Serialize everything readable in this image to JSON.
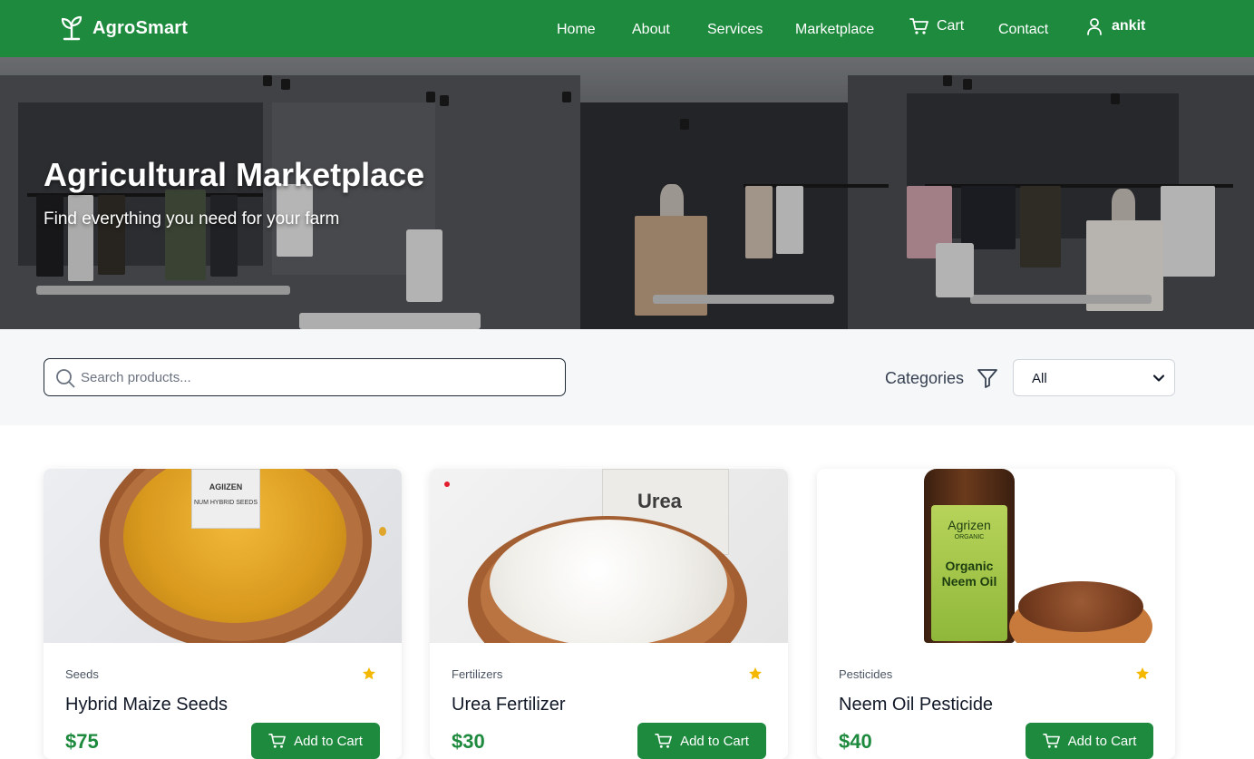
{
  "nav": {
    "brand": "AgroSmart",
    "links": {
      "home": "Home",
      "about": "About",
      "services": "Services",
      "marketplace": "Marketplace",
      "cart": "Cart",
      "contact": "Contact",
      "user": "ankit"
    }
  },
  "hero": {
    "title": "Agricultural Marketplace",
    "subtitle": "Find everything you need for your farm"
  },
  "filters": {
    "search_placeholder": "Search products...",
    "categories_label": "Categories",
    "selected_category": "All"
  },
  "products": [
    {
      "category": "Seeds",
      "name": "Hybrid Maize Seeds",
      "price": "$75",
      "button": "Add to Cart",
      "tag_brand": "AGIIZEN",
      "tag_text": "NUM HYBRID SEEDS"
    },
    {
      "category": "Fertilizers",
      "name": "Urea Fertilizer",
      "price": "$30",
      "button": "Add to Cart",
      "tag_text": "Urea"
    },
    {
      "category": "Pesticides",
      "name": "Neem Oil Pesticide",
      "price": "$40",
      "button": "Add to Cart",
      "label_brand": "Agrizen",
      "label_sub": "ORGANIC",
      "label_title": "Organic Neem Oil"
    }
  ],
  "colors": {
    "brand_green": "#1e8a3e",
    "star": "#f5b800"
  },
  "icons": [
    "sprout-icon",
    "cart-icon",
    "user-icon",
    "search-icon",
    "filter-icon",
    "chevron-down-icon",
    "star-icon"
  ]
}
